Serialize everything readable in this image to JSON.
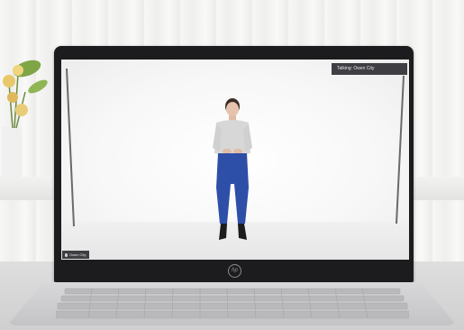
{
  "meeting": {
    "talking_label": "Talking: Owen City",
    "participant_name": "Owen City"
  },
  "laptop": {
    "logo": "hp"
  },
  "icons": {
    "mic": "mic-icon",
    "logo": "hp-logo-icon"
  },
  "colors": {
    "overlay_bg": "#202024",
    "trousers": "#2e4fa8",
    "top": "#d7d7d7"
  }
}
